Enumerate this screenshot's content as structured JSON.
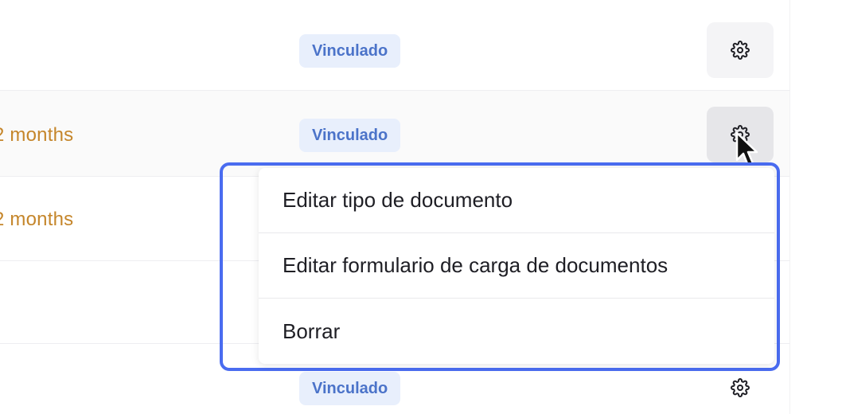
{
  "rows": [
    {
      "date": "",
      "status": "Vinculado"
    },
    {
      "date": "2 months",
      "status": "Vinculado"
    },
    {
      "date": "2 months",
      "status": ""
    },
    {
      "date": "",
      "status": ""
    },
    {
      "date": "",
      "status": "Vinculado"
    }
  ],
  "context_menu": {
    "items": [
      {
        "label": "Editar tipo de documento"
      },
      {
        "label": "Editar formulario de carga de documentos"
      },
      {
        "label": "Borrar"
      }
    ]
  },
  "colors": {
    "date_text": "#c5862b",
    "badge_bg": "#e8effc",
    "badge_text": "#4b73c9",
    "highlight_border": "#4a6cf0"
  },
  "icons": {
    "row_action": "gear-icon",
    "pointer": "mouse-cursor-icon"
  }
}
